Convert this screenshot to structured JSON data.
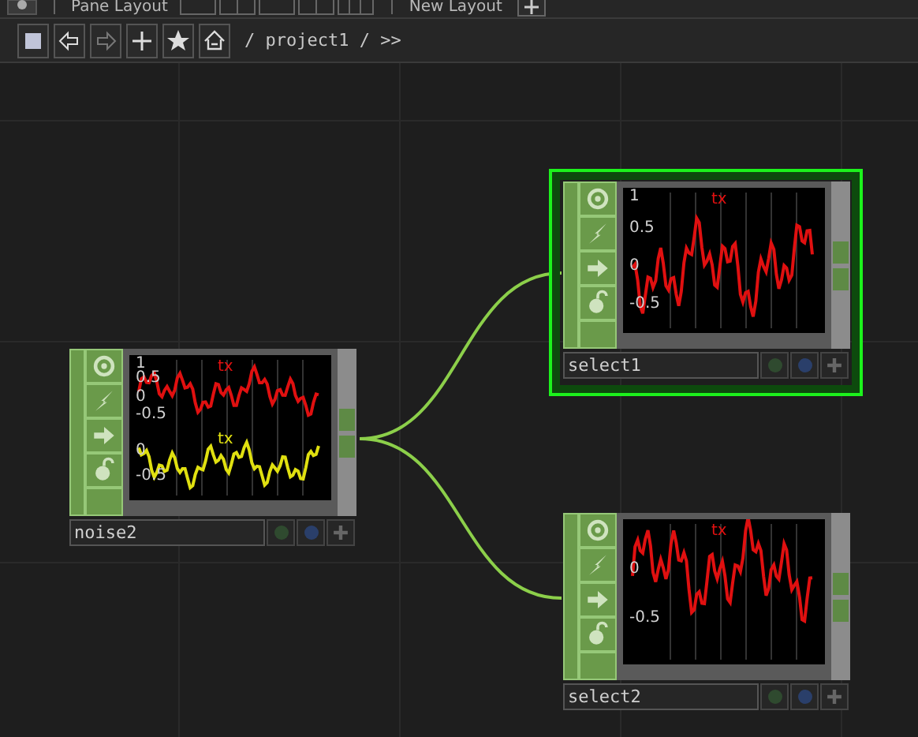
{
  "toolbar": {
    "pane_layout_label": "Pane Layout",
    "new_layout_label": "New Layout"
  },
  "nav": {
    "path": "/ project1 / >>"
  },
  "nodes": [
    {
      "name": "noise2",
      "selected": false,
      "channels": [
        {
          "name": "tx",
          "color": "#e01010",
          "axis_labels": [
            "1",
            "0.5",
            "0",
            "-0.5"
          ]
        },
        {
          "name": "tx",
          "color": "#e0e010",
          "axis_labels": [
            "0",
            "-0.5"
          ]
        }
      ]
    },
    {
      "name": "select1",
      "selected": true,
      "channels": [
        {
          "name": "tx",
          "color": "#e01010",
          "axis_labels": [
            "1",
            "0.5",
            "0",
            "-0.5"
          ]
        }
      ]
    },
    {
      "name": "select2",
      "selected": false,
      "channels": [
        {
          "name": "tx",
          "color": "#e01010",
          "axis_labels": [
            "0",
            "-0.5"
          ]
        }
      ]
    }
  ]
}
